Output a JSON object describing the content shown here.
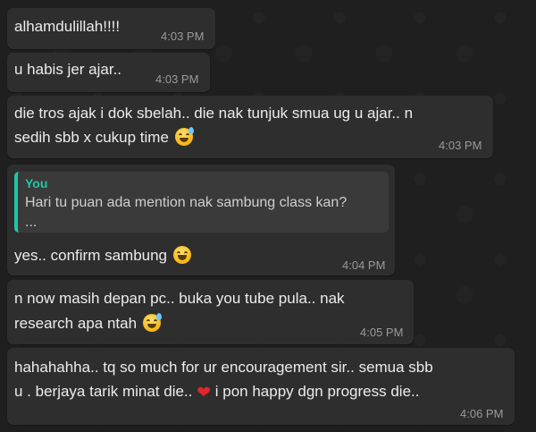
{
  "messages": [
    {
      "lines": [
        "alhamdulillah!!!!"
      ],
      "time": "4:03 PM"
    },
    {
      "lines": [
        "u habis jer ajar.."
      ],
      "time": "4:03 PM"
    },
    {
      "lines": [
        "die tros ajak i dok sbelah.. die nak tunjuk smua ug u ajar.. n",
        "sedih sbb x cukup time"
      ],
      "emoji": "sweat-smile-emoji",
      "time": "4:03 PM"
    },
    {
      "quote": {
        "author": "You",
        "text": "Hari tu puan ada mention nak sambung class kan?\n..."
      },
      "lines": [
        "yes.. confirm sambung"
      ],
      "emoji": "grinning-emoji",
      "time": "4:04 PM"
    },
    {
      "lines": [
        "n now masih depan pc.. buka you tube pula.. nak",
        "research apa ntah"
      ],
      "emoji": "sweat-smile-emoji",
      "time": "4:05 PM"
    },
    {
      "lines": [
        "hahahahha.. tq so much for ur encouragement sir.. semua sbb",
        "u . berjaya tarik minat die.."
      ],
      "line2_suffix": "i pon happy dgn progress die..",
      "heart": "❤",
      "time": "4:06 PM"
    }
  ]
}
